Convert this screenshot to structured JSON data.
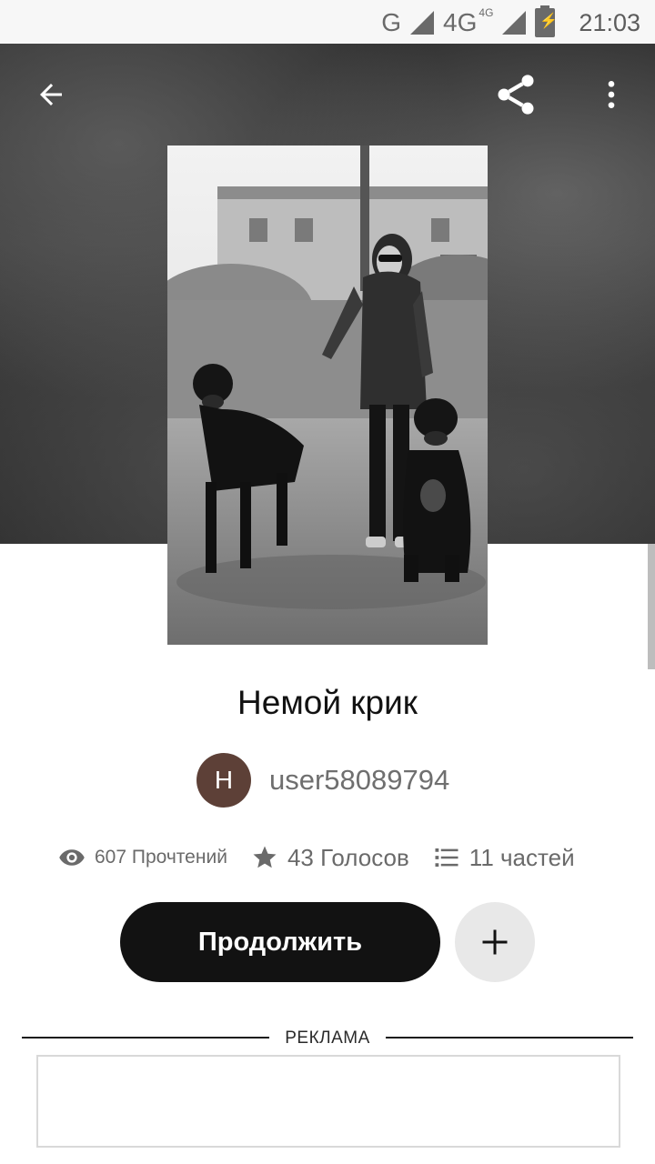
{
  "status_bar": {
    "network_1": "G",
    "network_2": "4G",
    "network_2_sup": "4G",
    "time": "21:03"
  },
  "toolbar": {
    "back_icon": "arrow-left-icon",
    "share_icon": "share-icon",
    "more_icon": "more-vertical-icon"
  },
  "story": {
    "title": "Немой крик",
    "author_initial": "Н",
    "author_name": "user58089794",
    "avatar_color": "#5d4037",
    "reads": "607 Прочтений",
    "votes": "43 Голосов",
    "parts": "11 частей"
  },
  "actions": {
    "continue_label": "Продолжить",
    "add_icon": "plus-icon"
  },
  "ad": {
    "label": "РЕКЛАМА"
  }
}
